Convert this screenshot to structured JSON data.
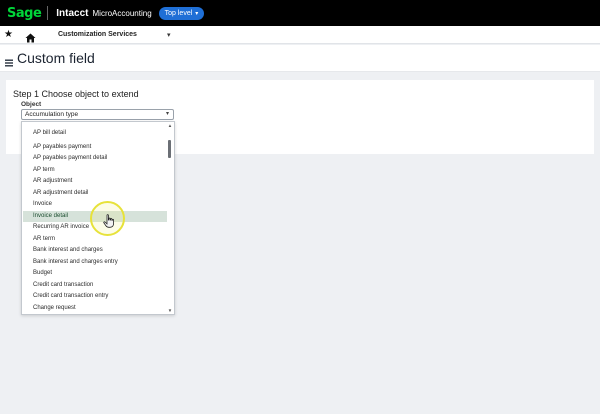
{
  "topbar": {
    "logo": "Sage",
    "product": "Intacct",
    "company": "MicroAccounting",
    "entity_button": "Top level",
    "chevron": "▾"
  },
  "navbar": {
    "star_icon": "★",
    "menu_title": "Customization Services",
    "menu_chevron": "▾"
  },
  "page": {
    "title": "Custom field"
  },
  "form": {
    "step_title": "Step 1 Choose object to extend",
    "object_label": "Object",
    "object_value": "Accumulation type",
    "select_chevron": "▾"
  },
  "dropdown": {
    "scroll_up": "▲",
    "scroll_down": "▼",
    "items": [
      "AP bill detail",
      "AP payables payment",
      "AP payables payment detail",
      "AP term",
      "AR adjustment",
      "AR adjustment detail",
      "Invoice",
      "Invoice detail",
      "Recurring AR invoice",
      "AR term",
      "Bank interest and charges",
      "Bank interest and charges entry",
      "Budget",
      "Credit card transaction",
      "Credit card transaction entry",
      "Change request"
    ],
    "selected_item": "Invoice detail"
  },
  "colors": {
    "topbar": "#000000",
    "logo": "#00d639",
    "entity_button": "#1f6fd6",
    "selected_row": "#d6e2da",
    "cursor_highlight": "#e7e23a"
  }
}
